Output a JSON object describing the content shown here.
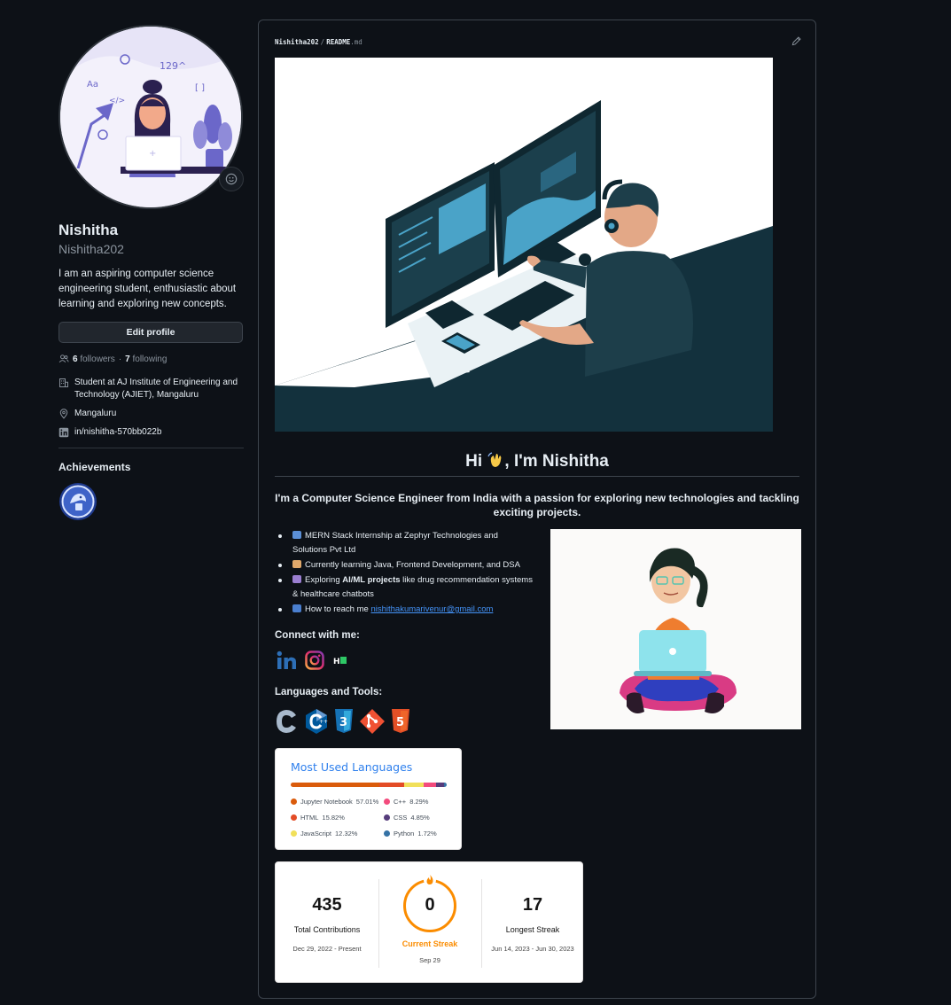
{
  "profile": {
    "fullname": "Nishitha",
    "username": "Nishitha202",
    "bio": "I am an aspiring computer science engineering student, enthusiastic about learning and exploring new concepts.",
    "edit_label": "Edit profile",
    "followers_count": "6",
    "followers_label": "followers",
    "dot": "·",
    "following_count": "7",
    "following_label": "following",
    "org": "Student at AJ Institute of Engineering and Technology (AJIET), Mangaluru",
    "location": "Mangaluru",
    "linkedin": "in/nishitha-570bb022b",
    "achievements_title": "Achievements"
  },
  "readme": {
    "crumb_user": "Nishitha202",
    "crumb_sep": "/",
    "crumb_file": "README",
    "crumb_ext": ".md",
    "hi_before": "Hi ",
    "hi_after": ", I'm Nishitha",
    "intro": "I'm a Computer Science Engineer from India with a passion for exploring new technologies and tackling exciting projects.",
    "bullets": {
      "b1": "MERN Stack Internship at Zephyr Technologies and Solutions Pvt Ltd",
      "b2": "Currently learning Java, Frontend Development, and DSA",
      "b3_pre": "Exploring ",
      "b3_bold": "AI/ML projects",
      "b3_post": " like drug recommendation systems & healthcare chatbots",
      "b4_pre": "How to reach me ",
      "b4_email": "nishithakumarivenur@gmail.com"
    },
    "connect_title": "Connect with me:",
    "tools_title": "Languages and Tools:",
    "social_icons": [
      "linkedin-icon",
      "instagram-icon",
      "hackerrank-icon"
    ],
    "tool_icons": [
      "c-icon",
      "cplusplus-icon",
      "css3-icon",
      "git-icon",
      "html5-icon"
    ]
  },
  "languages_card": {
    "title": "Most Used Languages",
    "items": [
      {
        "name": "Jupyter Notebook",
        "pct": "57.01%",
        "value": 57.01,
        "color": "#DA5B0B"
      },
      {
        "name": "C++",
        "pct": "8.29%",
        "value": 8.29,
        "color": "#f34b7d"
      },
      {
        "name": "HTML",
        "pct": "15.82%",
        "value": 15.82,
        "color": "#e34c26"
      },
      {
        "name": "CSS",
        "pct": "4.85%",
        "value": 4.85,
        "color": "#563d7c"
      },
      {
        "name": "JavaScript",
        "pct": "12.32%",
        "value": 12.32,
        "color": "#f1e05a"
      },
      {
        "name": "Python",
        "pct": "1.72%",
        "value": 1.72,
        "color": "#3572A5"
      }
    ]
  },
  "streak_card": {
    "total": "435",
    "total_label": "Total Contributions",
    "total_range": "Dec 29, 2022 - Present",
    "current": "0",
    "current_label": "Current Streak",
    "current_date": "Sep 29",
    "longest": "17",
    "longest_label": "Longest Streak",
    "longest_range": "Jun 14, 2023 - Jun 30, 2023",
    "accent": "#fb8c00"
  }
}
